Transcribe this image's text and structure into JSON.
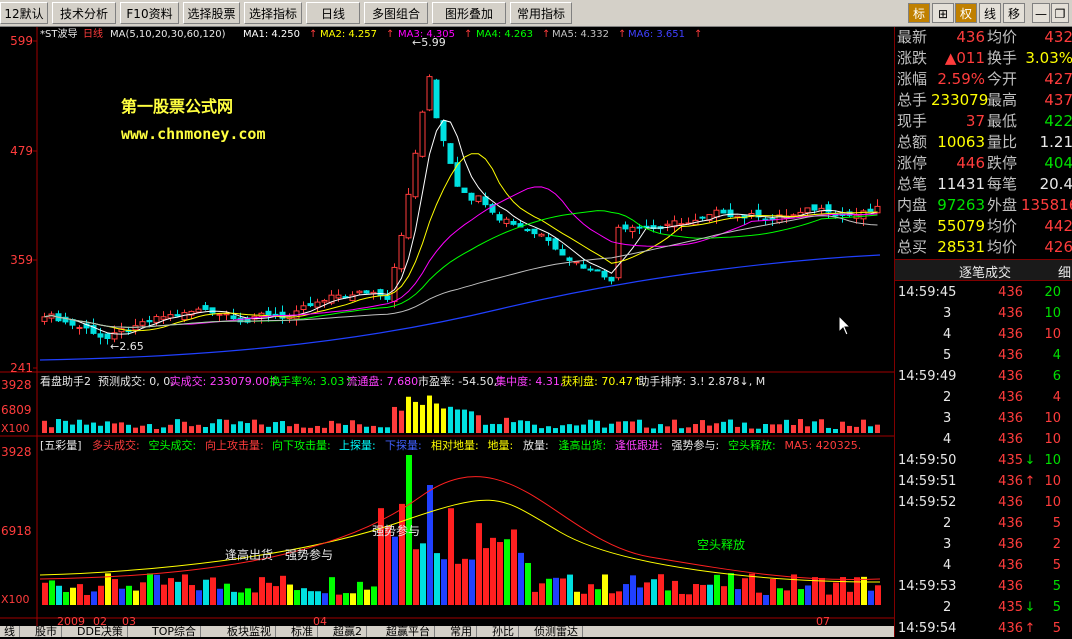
{
  "toolbar": {
    "items": [
      "12默认",
      "技术分析",
      "F10资料",
      "选择股票",
      "选择指标",
      "日线",
      "多图组合",
      "图形叠加",
      "常用指标"
    ],
    "right": [
      "标",
      "⊞",
      "权",
      "线",
      "移"
    ]
  },
  "main_chart": {
    "stock_name": "*ST波导",
    "period": "日线",
    "ma_params": "MA(5,10,20,30,60,120)",
    "ma_values": [
      {
        "label": "MA1:",
        "value": "4.250",
        "arrow": "↑",
        "color": "#ffffff"
      },
      {
        "label": "MA2:",
        "value": "4.257",
        "arrow": "↑",
        "color": "#ffff00"
      },
      {
        "label": "MA3:",
        "value": "4.305",
        "arrow": "↑",
        "color": "#ff00ff"
      },
      {
        "label": "MA4:",
        "value": "4.263",
        "arrow": "↑",
        "color": "#00ff00"
      },
      {
        "label": "MA5:",
        "value": "4.332",
        "arrow": "↑",
        "color": "#c0c0c0"
      },
      {
        "label": "MA6:",
        "value": "3.651",
        "arrow": "↑",
        "color": "#4040ff"
      }
    ],
    "watermark_title": "第一股票公式网",
    "watermark_url": "www.chnmoney.com",
    "y_labels": [
      "599",
      "479",
      "359",
      "241"
    ],
    "high_label": "←5.99",
    "low_label": "←2.65"
  },
  "vol_panel": {
    "title": "看盘助手2",
    "fields": [
      {
        "t": "预测成交: 0, 0,",
        "c": "#e8e8e8"
      },
      {
        "t": "实成交: 233079.00↑,",
        "c": "#ff40ff"
      },
      {
        "t": "换手率%: 3.03↑,",
        "c": "#00ff00"
      },
      {
        "t": "流通盘: 7.680,",
        "c": "#ff40ff"
      },
      {
        "t": "市盈率: -54.50,",
        "c": "#e8e8e8"
      },
      {
        "t": "集中度: 4.31,",
        "c": "#ff40ff"
      },
      {
        "t": "获利盘: 70.47↑,",
        "c": "#ffff00"
      },
      {
        "t": "助手排序: 3.! 2.878↓, M",
        "c": "#e8e8e8"
      }
    ],
    "y_labels": [
      "3928",
      "6809",
      "X100"
    ]
  },
  "five_panel": {
    "title": "[五彩量]",
    "fields": [
      {
        "t": "多头成交:",
        "c": "#ff3c3c"
      },
      {
        "t": "空头成交:",
        "c": "#00ff00"
      },
      {
        "t": "向上攻击量:",
        "c": "#ff3c3c"
      },
      {
        "t": "向下攻击量:",
        "c": "#00ff00"
      },
      {
        "t": "上探量:",
        "c": "#00ffff"
      },
      {
        "t": "下探量:",
        "c": "#4060ff"
      },
      {
        "t": "相对地量:",
        "c": "#ffff00"
      },
      {
        "t": "地量:",
        "c": "#ffff00"
      },
      {
        "t": "放量:",
        "c": "#e8e8e8"
      },
      {
        "t": "逢高出货:",
        "c": "#00ff00"
      },
      {
        "t": "逢低跟进:",
        "c": "#ff40ff"
      },
      {
        "t": "强势参与:",
        "c": "#e8e8e8"
      },
      {
        "t": "空头释放:",
        "c": "#00ff00"
      },
      {
        "t": "MA5: 420325.",
        "c": "#ff3c3c"
      }
    ],
    "y_labels": [
      "3928",
      "6918",
      "X100"
    ],
    "annotations": [
      "逢高出货",
      "强势参与",
      "强势参与",
      "空头释放"
    ],
    "date_labels": [
      "2009",
      "02",
      "03",
      "04",
      "07"
    ]
  },
  "quote": [
    {
      "l": "最新",
      "v": "436",
      "vc": "red",
      "l2": "均价",
      "v2": "432",
      "v2c": "red"
    },
    {
      "l": "涨跌",
      "v": "▲011",
      "vc": "red",
      "l2": "换手",
      "v2": "3.03%",
      "v2c": "yel"
    },
    {
      "l": "涨幅",
      "v": "2.59%",
      "vc": "red",
      "l2": "今开",
      "v2": "427",
      "v2c": "red"
    },
    {
      "l": "总手",
      "v": "233079",
      "vc": "yel",
      "l2": "最高",
      "v2": "437",
      "v2c": "red"
    },
    {
      "l": "现手",
      "v": "37",
      "vc": "red",
      "l2": "最低",
      "v2": "422",
      "v2c": "green"
    },
    {
      "l": "总额",
      "v": "10063",
      "vc": "yel",
      "l2": "量比",
      "v2": "1.21",
      "v2c": "wht"
    },
    {
      "l": "涨停",
      "v": "446",
      "vc": "red",
      "l2": "跌停",
      "v2": "404",
      "v2c": "green"
    },
    {
      "l": "总笔",
      "v": "11431",
      "vc": "wht",
      "l2": "每笔",
      "v2": "20.4",
      "v2c": "wht"
    },
    {
      "l": "内盘",
      "v": "97263",
      "vc": "green",
      "l2": "外盘",
      "v2": "135816",
      "v2c": "red"
    },
    {
      "l": "总卖",
      "v": "55079",
      "vc": "yel",
      "l2": "均价",
      "v2": "442",
      "v2c": "red"
    },
    {
      "l": "总买",
      "v": "28531",
      "vc": "yel",
      "l2": "均价",
      "v2": "426",
      "v2c": "red"
    }
  ],
  "ticks_header": {
    "label": "逐笔成交",
    "side": "细"
  },
  "ticks": [
    {
      "t": "14:59:45",
      "p": "436",
      "a": "",
      "v": "20",
      "vc": "green"
    },
    {
      "t": "3",
      "p": "436",
      "a": "",
      "v": "10",
      "vc": "green"
    },
    {
      "t": "4",
      "p": "436",
      "a": "",
      "v": "10",
      "vc": "red"
    },
    {
      "t": "5",
      "p": "436",
      "a": "",
      "v": "4",
      "vc": "green"
    },
    {
      "t": "14:59:49",
      "p": "436",
      "a": "",
      "v": "6",
      "vc": "green"
    },
    {
      "t": "2",
      "p": "436",
      "a": "",
      "v": "4",
      "vc": "red"
    },
    {
      "t": "3",
      "p": "436",
      "a": "",
      "v": "10",
      "vc": "red"
    },
    {
      "t": "4",
      "p": "436",
      "a": "",
      "v": "10",
      "vc": "red"
    },
    {
      "t": "14:59:50",
      "p": "435",
      "a": "↓",
      "v": "10",
      "vc": "green"
    },
    {
      "t": "14:59:51",
      "p": "436",
      "a": "↑",
      "v": "10",
      "vc": "red"
    },
    {
      "t": "14:59:52",
      "p": "436",
      "a": "",
      "v": "10",
      "vc": "red"
    },
    {
      "t": "2",
      "p": "436",
      "a": "",
      "v": "5",
      "vc": "red"
    },
    {
      "t": "3",
      "p": "436",
      "a": "",
      "v": "2",
      "vc": "red"
    },
    {
      "t": "4",
      "p": "436",
      "a": "",
      "v": "5",
      "vc": "red"
    },
    {
      "t": "14:59:53",
      "p": "436",
      "a": "",
      "v": "5",
      "vc": "green"
    },
    {
      "t": "2",
      "p": "435",
      "a": "↓",
      "v": "5",
      "vc": "green"
    },
    {
      "t": "14:59:54",
      "p": "436",
      "a": "↑",
      "v": "5",
      "vc": "red"
    }
  ],
  "bottom_tabs": [
    "线",
    "股市",
    "DDE决策",
    "TOP综合",
    "板块监视",
    "标准",
    "超赢2",
    "超赢平台",
    "常用",
    "孙比",
    "侦测雷达"
  ]
}
